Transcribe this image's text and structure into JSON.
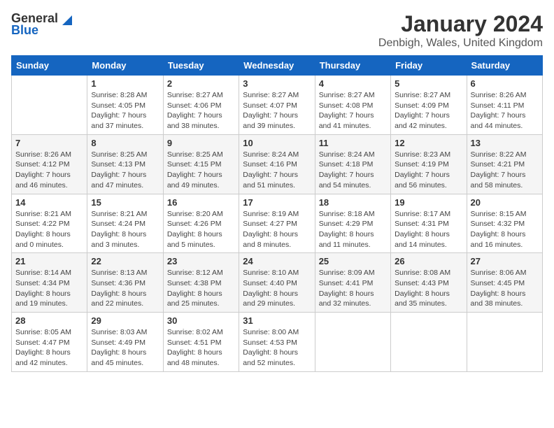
{
  "logo": {
    "general": "General",
    "blue": "Blue"
  },
  "title": "January 2024",
  "subtitle": "Denbigh, Wales, United Kingdom",
  "days_of_week": [
    "Sunday",
    "Monday",
    "Tuesday",
    "Wednesday",
    "Thursday",
    "Friday",
    "Saturday"
  ],
  "weeks": [
    [
      {
        "day": "",
        "info": ""
      },
      {
        "day": "1",
        "info": "Sunrise: 8:28 AM\nSunset: 4:05 PM\nDaylight: 7 hours\nand 37 minutes."
      },
      {
        "day": "2",
        "info": "Sunrise: 8:27 AM\nSunset: 4:06 PM\nDaylight: 7 hours\nand 38 minutes."
      },
      {
        "day": "3",
        "info": "Sunrise: 8:27 AM\nSunset: 4:07 PM\nDaylight: 7 hours\nand 39 minutes."
      },
      {
        "day": "4",
        "info": "Sunrise: 8:27 AM\nSunset: 4:08 PM\nDaylight: 7 hours\nand 41 minutes."
      },
      {
        "day": "5",
        "info": "Sunrise: 8:27 AM\nSunset: 4:09 PM\nDaylight: 7 hours\nand 42 minutes."
      },
      {
        "day": "6",
        "info": "Sunrise: 8:26 AM\nSunset: 4:11 PM\nDaylight: 7 hours\nand 44 minutes."
      }
    ],
    [
      {
        "day": "7",
        "info": "Sunrise: 8:26 AM\nSunset: 4:12 PM\nDaylight: 7 hours\nand 46 minutes."
      },
      {
        "day": "8",
        "info": "Sunrise: 8:25 AM\nSunset: 4:13 PM\nDaylight: 7 hours\nand 47 minutes."
      },
      {
        "day": "9",
        "info": "Sunrise: 8:25 AM\nSunset: 4:15 PM\nDaylight: 7 hours\nand 49 minutes."
      },
      {
        "day": "10",
        "info": "Sunrise: 8:24 AM\nSunset: 4:16 PM\nDaylight: 7 hours\nand 51 minutes."
      },
      {
        "day": "11",
        "info": "Sunrise: 8:24 AM\nSunset: 4:18 PM\nDaylight: 7 hours\nand 54 minutes."
      },
      {
        "day": "12",
        "info": "Sunrise: 8:23 AM\nSunset: 4:19 PM\nDaylight: 7 hours\nand 56 minutes."
      },
      {
        "day": "13",
        "info": "Sunrise: 8:22 AM\nSunset: 4:21 PM\nDaylight: 7 hours\nand 58 minutes."
      }
    ],
    [
      {
        "day": "14",
        "info": "Sunrise: 8:21 AM\nSunset: 4:22 PM\nDaylight: 8 hours\nand 0 minutes."
      },
      {
        "day": "15",
        "info": "Sunrise: 8:21 AM\nSunset: 4:24 PM\nDaylight: 8 hours\nand 3 minutes."
      },
      {
        "day": "16",
        "info": "Sunrise: 8:20 AM\nSunset: 4:26 PM\nDaylight: 8 hours\nand 5 minutes."
      },
      {
        "day": "17",
        "info": "Sunrise: 8:19 AM\nSunset: 4:27 PM\nDaylight: 8 hours\nand 8 minutes."
      },
      {
        "day": "18",
        "info": "Sunrise: 8:18 AM\nSunset: 4:29 PM\nDaylight: 8 hours\nand 11 minutes."
      },
      {
        "day": "19",
        "info": "Sunrise: 8:17 AM\nSunset: 4:31 PM\nDaylight: 8 hours\nand 14 minutes."
      },
      {
        "day": "20",
        "info": "Sunrise: 8:15 AM\nSunset: 4:32 PM\nDaylight: 8 hours\nand 16 minutes."
      }
    ],
    [
      {
        "day": "21",
        "info": "Sunrise: 8:14 AM\nSunset: 4:34 PM\nDaylight: 8 hours\nand 19 minutes."
      },
      {
        "day": "22",
        "info": "Sunrise: 8:13 AM\nSunset: 4:36 PM\nDaylight: 8 hours\nand 22 minutes."
      },
      {
        "day": "23",
        "info": "Sunrise: 8:12 AM\nSunset: 4:38 PM\nDaylight: 8 hours\nand 25 minutes."
      },
      {
        "day": "24",
        "info": "Sunrise: 8:10 AM\nSunset: 4:40 PM\nDaylight: 8 hours\nand 29 minutes."
      },
      {
        "day": "25",
        "info": "Sunrise: 8:09 AM\nSunset: 4:41 PM\nDaylight: 8 hours\nand 32 minutes."
      },
      {
        "day": "26",
        "info": "Sunrise: 8:08 AM\nSunset: 4:43 PM\nDaylight: 8 hours\nand 35 minutes."
      },
      {
        "day": "27",
        "info": "Sunrise: 8:06 AM\nSunset: 4:45 PM\nDaylight: 8 hours\nand 38 minutes."
      }
    ],
    [
      {
        "day": "28",
        "info": "Sunrise: 8:05 AM\nSunset: 4:47 PM\nDaylight: 8 hours\nand 42 minutes."
      },
      {
        "day": "29",
        "info": "Sunrise: 8:03 AM\nSunset: 4:49 PM\nDaylight: 8 hours\nand 45 minutes."
      },
      {
        "day": "30",
        "info": "Sunrise: 8:02 AM\nSunset: 4:51 PM\nDaylight: 8 hours\nand 48 minutes."
      },
      {
        "day": "31",
        "info": "Sunrise: 8:00 AM\nSunset: 4:53 PM\nDaylight: 8 hours\nand 52 minutes."
      },
      {
        "day": "",
        "info": ""
      },
      {
        "day": "",
        "info": ""
      },
      {
        "day": "",
        "info": ""
      }
    ]
  ]
}
